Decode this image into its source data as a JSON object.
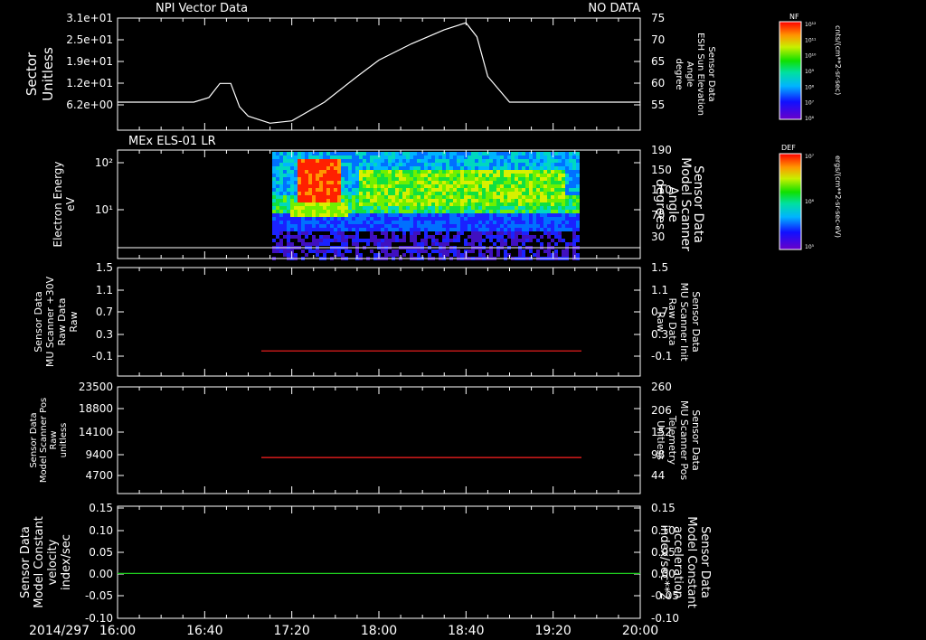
{
  "chart_data": [
    {
      "type": "line",
      "panel_id": "p1",
      "title": "NPI Vector Data",
      "status": "NO DATA",
      "ylabel_left": [
        "Sector",
        "Unitless"
      ],
      "ylabel_right": [
        "Sensor Data",
        "ESH Sun Elevation",
        "Angle",
        "degree"
      ],
      "yticks_left": [
        "3.1e+01",
        "2.5e+01",
        "1.9e+01",
        "1.2e+01",
        "6.2e+00"
      ],
      "yticks_right": [
        "75",
        "70",
        "65",
        "60",
        "55"
      ],
      "ylim_right": [
        51,
        75
      ],
      "series": [
        {
          "color": "#ffffff",
          "x_minutes": [
            0,
            35,
            42,
            47,
            52,
            56,
            60,
            70,
            80,
            95,
            110,
            120,
            135,
            150,
            160,
            165,
            170,
            180,
            190,
            200,
            240
          ],
          "y": [
            57,
            57,
            58,
            61,
            61,
            56,
            54,
            52.5,
            53,
            57,
            62.5,
            66,
            69.5,
            72.5,
            74,
            71,
            62.5,
            57,
            57,
            57,
            57
          ]
        }
      ]
    },
    {
      "type": "heatmap",
      "panel_id": "p2",
      "title": "MEx ELS-01 LR",
      "ylabel_left": [
        "Electron Energy",
        "eV"
      ],
      "ylabel_right": [
        "Sensor Data",
        "Model Scanner",
        "Angle",
        "degrees"
      ],
      "yticks_left": [
        "10²",
        "10¹"
      ],
      "yticks_right": [
        "190",
        "150",
        "110",
        "70",
        "30"
      ],
      "data_x_range_minutes": [
        71,
        211
      ],
      "colorbar": {
        "label": "DEF",
        "units": "ergs/(cm**2-sr-sec-eV)",
        "ticks": [
          "10⁷",
          "10⁶",
          "10⁵"
        ]
      }
    },
    {
      "type": "line",
      "panel_id": "p3",
      "ylabel_left": [
        "Sensor Data",
        "MU Scanner +30V",
        "Raw Data",
        "Raw"
      ],
      "ylabel_right": [
        "Sensor Data",
        "MU Scanner Init",
        "Raw Data",
        "Raw"
      ],
      "ylabel_right_color": "#ff2020",
      "yticks_left": [
        "1.5",
        "1.1",
        "0.7",
        "0.3",
        "-0.1"
      ],
      "yticks_right": [
        "1.5",
        "1.1",
        "0.7",
        "0.3",
        "-0.1"
      ],
      "ylim": [
        -0.4,
        1.5
      ],
      "series": [
        {
          "color": "#ff2020",
          "x_minutes": [
            66,
            213
          ],
          "y": [
            0.04,
            0.04
          ]
        }
      ]
    },
    {
      "type": "line",
      "panel_id": "p4",
      "ylabel_left": [
        "Sensor Data",
        "Model Scanner Pos",
        "Raw",
        "unitless"
      ],
      "ylabel_right": [
        "Sensor Data",
        "MU Scanner Pos",
        "Telemetry",
        "Unitless"
      ],
      "ylabel_right_color": "#ff2020",
      "yticks_left": [
        "23500",
        "18800",
        "14100",
        "9400",
        "4700"
      ],
      "yticks_right": [
        "260",
        "206",
        "152",
        "98",
        "44"
      ],
      "ylim": [
        0,
        23500
      ],
      "series": [
        {
          "color": "#ff2020",
          "x_minutes": [
            66,
            213
          ],
          "y": [
            7950,
            7950
          ]
        }
      ]
    },
    {
      "type": "line",
      "panel_id": "p5",
      "ylabel_left": [
        "Sensor Data",
        "Model Constant",
        "velocity",
        "index/sec"
      ],
      "ylabel_right": [
        "Sensor Data",
        "Model Constant",
        "acceleration",
        "index/sec**2"
      ],
      "ylabel_right_color": "#20d020",
      "yticks_left": [
        "0.15",
        "0.10",
        "0.05",
        "0.00",
        "-0.05",
        "-0.10"
      ],
      "yticks_right": [
        "0.15",
        "0.10",
        "0.05",
        "0.00",
        "-0.05",
        "-0.10"
      ],
      "ylim": [
        -0.1,
        0.15
      ],
      "series": [
        {
          "color": "#20d020",
          "x_minutes": [
            0,
            240
          ],
          "y": [
            0,
            0
          ]
        }
      ]
    }
  ],
  "x_axis": {
    "date_label": "2014/297",
    "tick_labels": [
      "16:00",
      "16:40",
      "17:20",
      "18:00",
      "18:40",
      "19:20",
      "20:00"
    ],
    "xlim_minutes": [
      0,
      240
    ]
  },
  "colorbar_nf": {
    "label": "NF",
    "units": "cnts/(cm**2-sr-sec)",
    "ticks": [
      "10¹²",
      "10¹¹",
      "10¹⁰",
      "10⁹",
      "10⁸",
      "10⁷",
      "10⁶"
    ]
  }
}
